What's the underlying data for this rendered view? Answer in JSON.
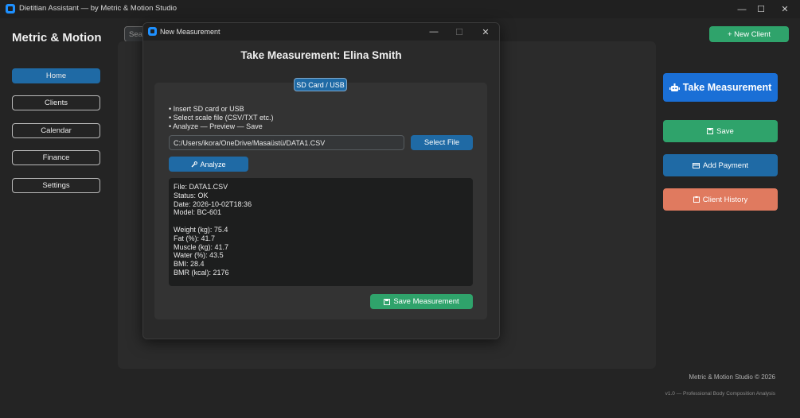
{
  "window": {
    "title": "Dietitian Assistant — by Metric & Motion Studio",
    "minimize": "—",
    "maximize": "☐",
    "close": "✕"
  },
  "sidebar": {
    "brand": "Metric & Motion",
    "items": [
      {
        "label": "Home",
        "active": true
      },
      {
        "label": "Clients",
        "active": false
      },
      {
        "label": "Calendar",
        "active": false
      },
      {
        "label": "Finance",
        "active": false
      },
      {
        "label": "Settings",
        "active": false
      }
    ]
  },
  "search": {
    "placeholder": "Search"
  },
  "header": {
    "new_client_label": "+ New Client"
  },
  "actions": {
    "take_measurement": "Take Measurement",
    "save": "Save",
    "add_payment": "Add Payment",
    "client_history": "Client History"
  },
  "footer": {
    "copyright": "Metric & Motion Studio © 2026",
    "version": "v1.0 — Professional Body Composition Analysis"
  },
  "dialog": {
    "title": "New Measurement",
    "heading": "Take Measurement: Elina Smith",
    "tab_label": "SD Card / USB",
    "instructions": [
      "• Insert SD card or USB",
      "• Select scale file (CSV/TXT etc.)",
      "• Analyze — Preview — Save"
    ],
    "file_path": "C:/Users/ikora/OneDrive/Masaüstü/DATA1.CSV",
    "select_file_label": "Select File",
    "analyze_label": "Analyze",
    "result_lines": [
      "File: DATA1.CSV",
      "Status: OK",
      "Date: 2026-10-02T18:36",
      "Model: BC-601",
      "",
      "Weight (kg): 75.4",
      "Fat (%): 41.7",
      "Muscle (kg): 41.7",
      "Water (%): 43.5",
      "BMI: 28.4",
      "BMR (kcal): 2176"
    ],
    "save_measurement_label": "Save Measurement"
  },
  "colors": {
    "accent_blue": "#1f6aa5",
    "take_blue": "#1a6fd6",
    "green": "#2fa36b",
    "coral": "#e07a5f"
  }
}
